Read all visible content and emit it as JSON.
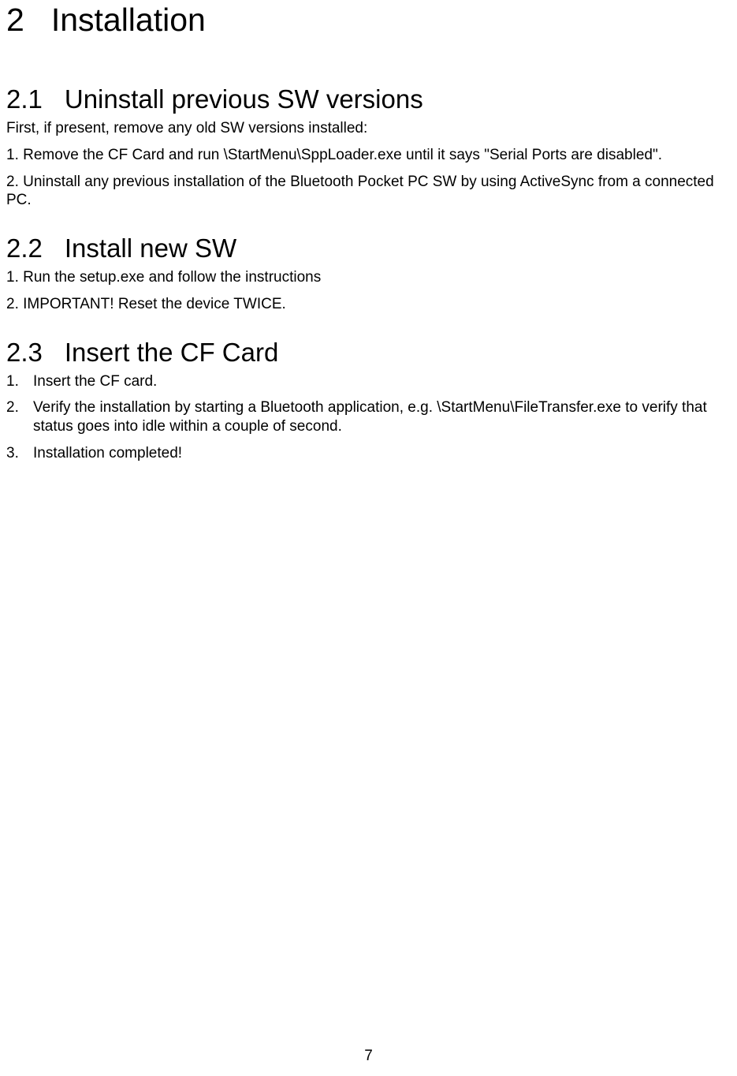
{
  "chapter": {
    "number": "2",
    "title": "Installation"
  },
  "sections": {
    "s1": {
      "number": "2.1",
      "title": "Uninstall previous SW versions",
      "intro": "First, if present, remove any old SW versions installed:",
      "item1": "1. Remove the CF Card and run \\StartMenu\\SppLoader.exe until it says \"Serial Ports are disabled\".",
      "item2": "2. Uninstall any previous installation of the Bluetooth Pocket PC SW by using ActiveSync from a connected PC."
    },
    "s2": {
      "number": "2.2",
      "title": "Install new SW",
      "item1": "1. Run the setup.exe and follow the instructions",
      "item2": "2. IMPORTANT! Reset the device TWICE."
    },
    "s3": {
      "number": "2.3",
      "title": "Insert the CF Card",
      "list": {
        "n1": "1.",
        "t1": "Insert the CF card.",
        "n2": "2.",
        "t2": "Verify the installation by starting a Bluetooth application, e.g. \\StartMenu\\FileTransfer.exe to verify that status goes into idle within a couple of second.",
        "n3": "3.",
        "t3": "Installation completed!"
      }
    }
  },
  "pageNumber": "7"
}
